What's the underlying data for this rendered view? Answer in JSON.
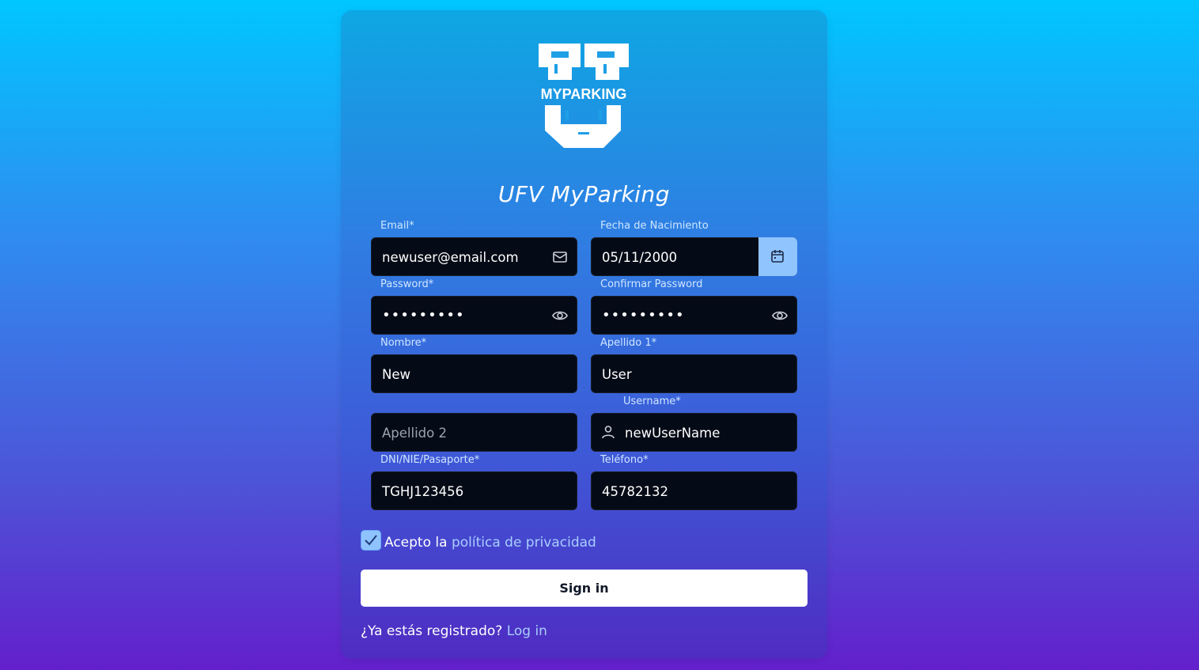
{
  "app": {
    "logo_text": "MYPARKING",
    "title": "UFV MyParking"
  },
  "form": {
    "email": {
      "label": "Email*",
      "value": "newuser@email.com",
      "icon": "mail-icon"
    },
    "birthdate": {
      "label": "Fecha de Nacimiento",
      "value": "05/11/2000",
      "icon": "calendar-icon"
    },
    "password": {
      "label": "Password*",
      "value": "•••••••••",
      "icon": "eye-icon"
    },
    "confirm_password": {
      "label": "Confirmar Password",
      "value": "•••••••••",
      "icon": "eye-icon"
    },
    "nombre": {
      "label": "Nombre*",
      "value": "New"
    },
    "apellido1": {
      "label": "Apellido 1*",
      "value": "User"
    },
    "apellido2": {
      "placeholder": "Apellido 2"
    },
    "username": {
      "label": "Username*",
      "value": "newUserName",
      "icon": "user-icon"
    },
    "dni": {
      "label": "DNI/NIE/Pasaporte*",
      "value": "TGHJ123456"
    },
    "telefono": {
      "label": "Teléfono*",
      "value": "45782132"
    }
  },
  "privacy": {
    "checked": true,
    "text": "Acepto la",
    "link": "política de privacidad"
  },
  "submit_label": "Sign in",
  "footer": {
    "text": "¿Ya estás registrado?",
    "link": "Log in"
  },
  "colors": {
    "field_bg": "#050b16",
    "accent": "#90c4ff",
    "link": "#a9cdfd"
  }
}
